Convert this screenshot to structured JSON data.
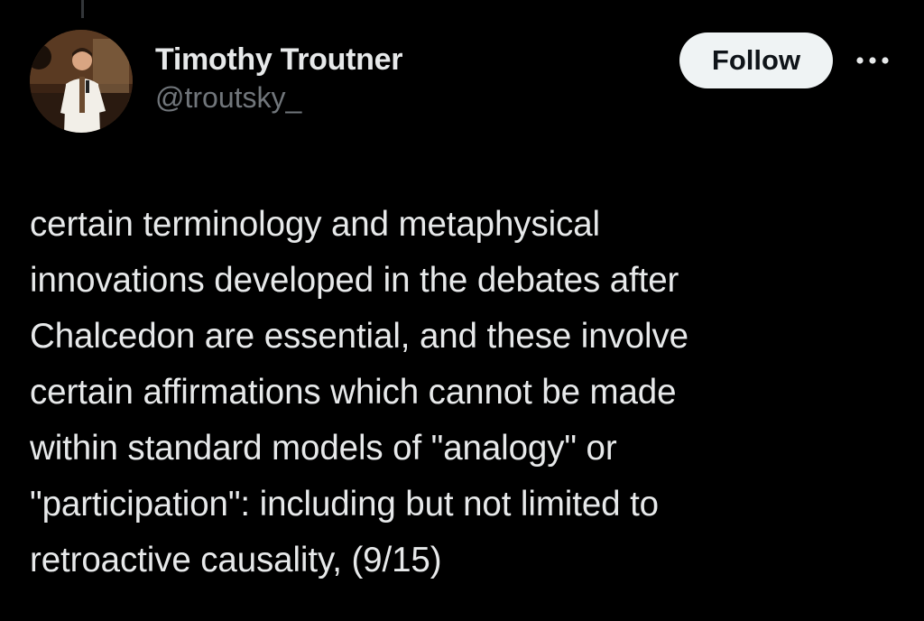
{
  "author": {
    "display_name": "Timothy Troutner",
    "handle": "@troutsky_"
  },
  "actions": {
    "follow_label": "Follow",
    "more_icon": "more-horizontal-icon"
  },
  "tweet": {
    "lines": [
      "certain terminology and metaphysical",
      "innovations developed in the debates after",
      "Chalcedon are essential, and these involve",
      "certain affirmations which cannot be made",
      "within standard models of \"analogy\" or",
      "\"participation\": including but not limited to",
      "retroactive causality, (9/15)"
    ]
  },
  "colors": {
    "background": "#000000",
    "text_primary": "#e7e9ea",
    "text_secondary": "#71767b",
    "button_bg": "#eff3f4",
    "button_text": "#0f1419"
  }
}
